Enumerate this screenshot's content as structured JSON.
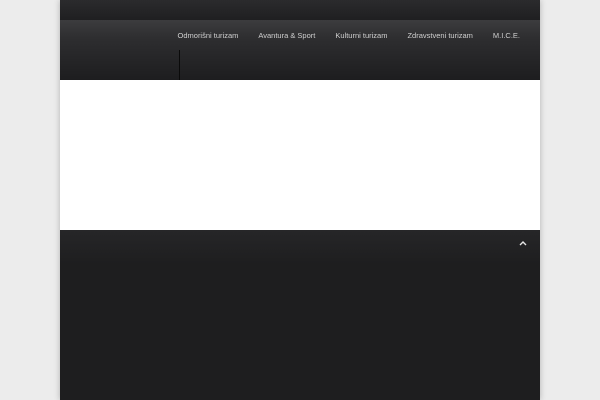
{
  "nav": {
    "items": [
      {
        "label": "Odmorišni turizam"
      },
      {
        "label": "Avantura & Sport"
      },
      {
        "label": "Kulturni turizam"
      },
      {
        "label": "Zdravstveni turizam"
      },
      {
        "label": "M.I.C.E."
      }
    ]
  },
  "footer": {
    "back_to_top_icon": "chevron-up-icon"
  }
}
